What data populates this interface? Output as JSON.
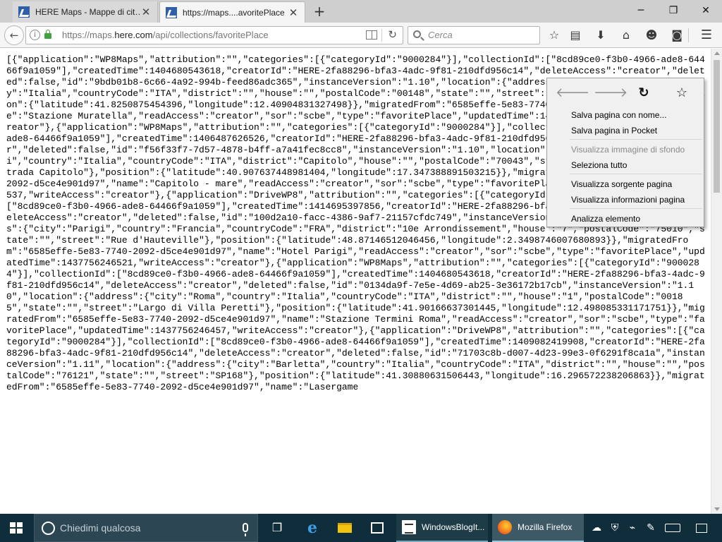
{
  "tabs": [
    {
      "title": "HERE Maps - Mappe di cit…",
      "active": false
    },
    {
      "title": "https://maps....avoritePlace",
      "active": true
    }
  ],
  "window_controls": {
    "minimize": "─",
    "maximize": "❐",
    "close": "✕"
  },
  "navbar": {
    "url_domain_prefix": "https://maps.",
    "url_domain": "here.com",
    "url_path": "/api/collections/favoritePlace",
    "search_placeholder": "Cerca"
  },
  "content_text": "[{\"application\":\"WP8Maps\",\"attribution\":\"\",\"categories\":[{\"categoryId\":\"9000284\"}],\"collectionId\":[\"8cd89ce0-f3b0-4966-ade8-64466f9a1059\"],\"createdTime\":1404680543618,\"creatorId\":\"HERE-2fa88296-bfa3-4adc-9f81-210dfd956c14\",\"deleteAccess\":\"creator\",\"deleted\":false,\"id\":\"9bdb01b8-6c66-4a92-994b-feed86adc365\",\"instanceVersion\":\"1.10\",\"location\":{\"address\":{\"city\":\"Roma\",\"country\":\"Italia\",\"countryCode\":\"ITA\",\"district\":\"\",\"house\":\"\",\"postalCode\":\"00148\",\"state\":\"\",\"street\":\"Via della Magliana\"},\"position\":{\"latitude\":41.8250875454396,\"longitude\":12.40904831327498}},\"migratedFrom\":\"6585effe-5e83-7740-2092-d5ce4e901d97\",\"name\":\"Stazione Muratella\",\"readAccess\":\"creator\",\"sor\":\"scbe\",\"type\":\"favoritePlace\",\"updatedTime\":1437756246467,\"writeAccess\":\"creator\"},{\"application\":\"WP8Maps\",\"attribution\":\"\",\"categories\":[{\"categoryId\":\"9000284\"}],\"collectionId\":[\"8cd89ce0-f3b0-4966-ade8-64466f9a1059\"],\"createdTime\":1406487626526,\"creatorId\":\"HERE-2fa88296-bfa3-4adc-9f81-210dfd956c14\",\"deleteAccess\":\"creator\",\"deleted\":false,\"id\":\"f56f33f7-7d57-4878-b4ff-a7a41fec8cc8\",\"instanceVersion\":\"1.10\",\"location\":{\"address\":{\"city\":\"Monopoli\",\"country\":\"Italia\",\"countryCode\":\"ITA\",\"district\":\"Capitolo\",\"house\":\"\",\"postalCode\":\"70043\",\"state\":\"\",\"street\":\"Strada Contrada Capitolo\"},\"position\":{\"latitude\":40.907637448981404,\"longitude\":17.347388891503215}},\"migratedFrom\":\"6585effe-5e83-7740-2092-d5ce4e901d97\",\"name\":\"Capitolo - mare\",\"readAccess\":\"creator\",\"sor\":\"scbe\",\"type\":\"favoritePlace\",\"updatedTime\":1437756246537,\"writeAccess\":\"creator\"},{\"application\":\"DriveWP8\",\"attribution\":\"\",\"categories\":[{\"categoryId\":\"9000284\"}],\"collectionId\":[\"8cd89ce0-f3b0-4966-ade8-64466f9a1059\"],\"createdTime\":1414695397856,\"creatorId\":\"HERE-2fa88296-bfa3-4adc-9f81-210dfd956c14\",\"deleteAccess\":\"creator\",\"deleted\":false,\"id\":\"100d2a10-facc-4386-9af7-21157cfdc749\",\"instanceVersion\":\"1.11\",\"location\":{\"address\":{\"city\":\"Parigi\",\"country\":\"Francia\",\"countryCode\":\"FRA\",\"district\":\"10e Arrondissement\",\"house\":\"7\",\"postalCode\":\"75010\",\"state\":\"\",\"street\":\"Rue d'Hauteville\"},\"position\":{\"latitude\":48.87146512046456,\"longitude\":2.3498746007680893}},\"migratedFrom\":\"6585effe-5e83-7740-2092-d5ce4e901d97\",\"name\":\"Hotel Parigi\",\"readAccess\":\"creator\",\"sor\":\"scbe\",\"type\":\"favoritePlace\",\"updatedTime\":1437756246521,\"writeAccess\":\"creator\"},{\"application\":\"WP8Maps\",\"attribution\":\"\",\"categories\":[{\"categoryId\":\"9000284\"}],\"collectionId\":[\"8cd89ce0-f3b0-4966-ade8-64466f9a1059\"],\"createdTime\":1404680543618,\"creatorId\":\"HERE-2fa88296-bfa3-4adc-9f81-210dfd956c14\",\"deleteAccess\":\"creator\",\"deleted\":false,\"id\":\"0134da9f-7e5e-4d69-ab25-3e36172b17cb\",\"instanceVersion\":\"1.10\",\"location\":{\"address\":{\"city\":\"Roma\",\"country\":\"Italia\",\"countryCode\":\"ITA\",\"district\":\"\",\"house\":\"1\",\"postalCode\":\"00185\",\"state\":\"\",\"street\":\"Largo di Villa Peretti\"},\"position\":{\"latitude\":41.90166637301445,\"longitude\":12.498085331171751}},\"migratedFrom\":\"6585effe-5e83-7740-2092-d5ce4e901d97\",\"name\":\"Stazione Termini Roma\",\"readAccess\":\"creator\",\"sor\":\"scbe\",\"type\":\"favoritePlace\",\"updatedTime\":1437756246457,\"writeAccess\":\"creator\"},{\"application\":\"DriveWP8\",\"attribution\":\"\",\"categories\":[{\"categoryId\":\"9000284\"}],\"collectionId\":[\"8cd89ce0-f3b0-4966-ade8-64466f9a1059\"],\"createdTime\":1409082419908,\"creatorId\":\"HERE-2fa88296-bfa3-4adc-9f81-210dfd956c14\",\"deleteAccess\":\"creator\",\"deleted\":false,\"id\":\"71703c8b-d007-4d23-99e3-0f6291f8ca1a\",\"instanceVersion\":\"1.11\",\"location\":{\"address\":{\"city\":\"Barletta\",\"country\":\"Italia\",\"countryCode\":\"ITA\",\"district\":\"\",\"house\":\"\",\"postalCode\":\"76121\",\"state\":\"\",\"street\":\"SP168\"},\"position\":{\"latitude\":41.30880631506443,\"longitude\":16.296572238206863}},\"migratedFrom\":\"6585effe-5e83-7740-2092-d5ce4e901d97\",\"name\":\"Lasergame",
  "context_menu": {
    "items": [
      {
        "label": "Salva pagina con nome...",
        "disabled": false
      },
      {
        "label": "Salva pagina in Pocket",
        "disabled": false
      },
      {
        "label": "Visualizza immagine di sfondo",
        "disabled": true
      },
      {
        "label": "Seleziona tutto",
        "disabled": false
      },
      {
        "label": "Visualizza sorgente pagina",
        "disabled": false
      },
      {
        "label": "Visualizza informazioni pagina",
        "disabled": false
      },
      {
        "label": "Analizza elemento",
        "disabled": false
      }
    ]
  },
  "taskbar": {
    "search_placeholder": "Chiedimi qualcosa",
    "apps": [
      {
        "label": "WindowsBlogIt..."
      },
      {
        "label": "Mozilla Firefox"
      }
    ]
  }
}
